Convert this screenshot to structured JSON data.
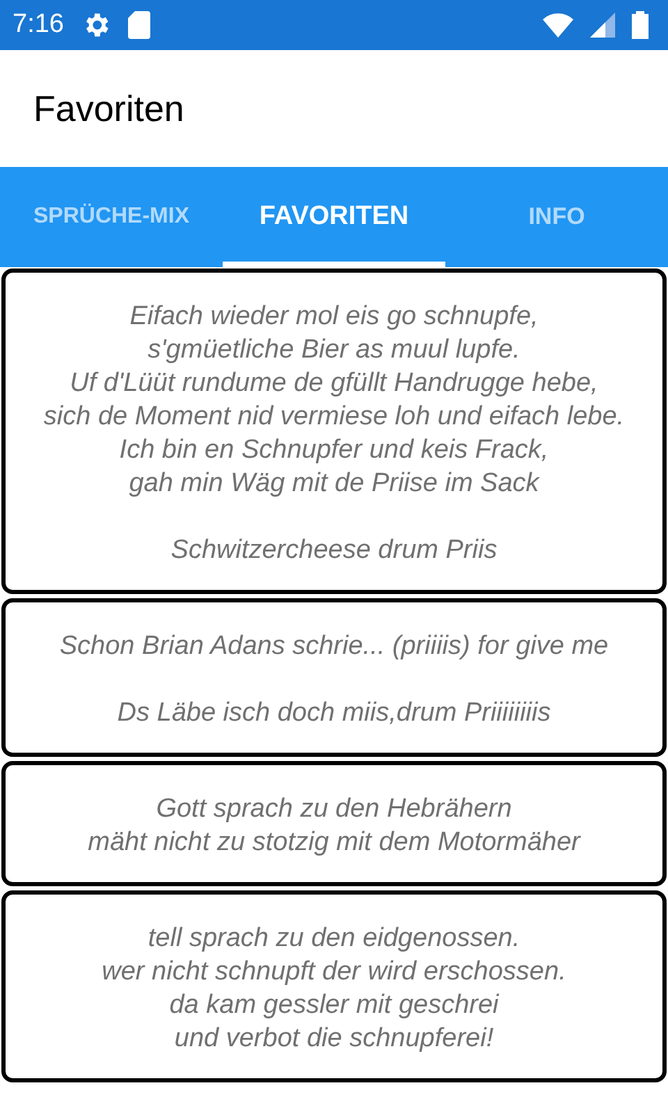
{
  "status_bar": {
    "time": "7:16"
  },
  "app_bar": {
    "title": "Favoriten"
  },
  "tabs": [
    {
      "label": "SPRÜCHE-MIX",
      "selected": false
    },
    {
      "label": "FAVORITEN",
      "selected": true
    },
    {
      "label": "INFO",
      "selected": false
    }
  ],
  "quotes": [
    "Eifach wieder mol eis go schnupfe,\ns'gmüetliche Bier as muul lupfe.\nUf d'Lüüt rundume de gfüllt Handrugge hebe,\nsich de Moment nid vermiese loh und eifach lebe.\nIch bin en Schnupfer und keis Frack,\ngah min Wäg mit de Priise im Sack\n\nSchwitzercheese drum Priis",
    "Schon Brian Adans schrie... (priiiis) for give me\n\nDs Läbe isch doch miis,drum Priiiiiiiis",
    "Gott sprach zu den Hebrähern\nmäht nicht zu stotzig mit dem Motormäher",
    "tell sprach zu den eidgenossen.\nwer nicht schnupft der wird erschossen.\nda kam gessler mit geschrei\nund verbot die schnupferei!"
  ]
}
